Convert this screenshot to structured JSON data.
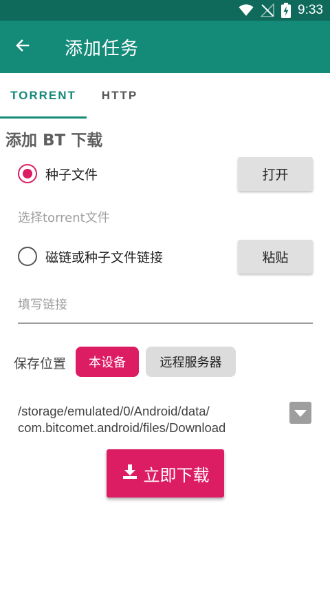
{
  "status_bar": {
    "time": "9:33",
    "icons": [
      "wifi-icon",
      "no-signal-icon",
      "battery-charging-icon"
    ]
  },
  "app_bar": {
    "title": "添加任务",
    "back_icon": "arrow-left-icon"
  },
  "tabs": [
    {
      "label": "TORRENT",
      "active": true
    },
    {
      "label": "HTTP",
      "active": false
    }
  ],
  "section_title": "添加 BT 下载",
  "torrent_file": {
    "label": "种子文件",
    "selected": true,
    "button_label": "打开",
    "hint": "选择torrent文件"
  },
  "magnet_link": {
    "label": "磁链或种子文件链接",
    "selected": false,
    "button_label": "粘贴",
    "placeholder": "填写链接",
    "value": ""
  },
  "save_location": {
    "label": "保存位置",
    "options": [
      "本设备",
      "远程服务器"
    ],
    "selected": "本设备",
    "path_line1": "/storage/emulated/0/Android/data/",
    "path_line2": "com.bitcomet.android/files/Download",
    "dropdown_icon": "caret-down-icon"
  },
  "download_button": {
    "label": "立即下载",
    "icon": "download-icon"
  },
  "colors": {
    "status_bar": "#0f6a5c",
    "app_bar": "#148a78",
    "accent": "#dc1d64",
    "button_gray": "#e0e0e0"
  }
}
